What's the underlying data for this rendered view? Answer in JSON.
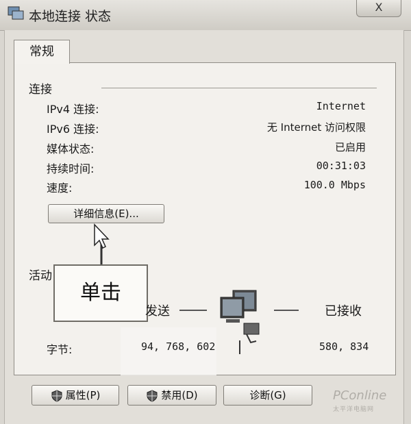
{
  "window": {
    "title": "本地连接 状态",
    "close_glyph": "X"
  },
  "tab": {
    "label": "常规"
  },
  "connection": {
    "group_label": "连接",
    "rows": [
      {
        "label": "IPv4 连接:",
        "value": "Internet"
      },
      {
        "label": "IPv6 连接:",
        "value": "无 Internet 访问权限"
      },
      {
        "label": "媒体状态:",
        "value": "已启用"
      },
      {
        "label": "持续时间:",
        "value": "00:31:03"
      },
      {
        "label": "速度:",
        "value": "100.0 Mbps"
      }
    ],
    "details_button": "详细信息(E)..."
  },
  "activity": {
    "group_label": "活动",
    "sent_label": "发送",
    "received_label": "已接收",
    "bytes_label": "字节:",
    "bytes_sent": "94, 768, 602",
    "bytes_received": "580, 834"
  },
  "annotation": {
    "callout_text": "单击"
  },
  "buttons": {
    "properties": "属性(P)",
    "disable": "禁用(D)",
    "diagnose": "诊断(G)"
  },
  "watermark": {
    "main": "PConline",
    "sub": "太平洋电脑网"
  },
  "icons": {
    "title": "network-connection-icon",
    "shield": "uac-shield-icon",
    "computer": "networked-computer-icon",
    "pointer": "cursor-arrow-icon"
  }
}
